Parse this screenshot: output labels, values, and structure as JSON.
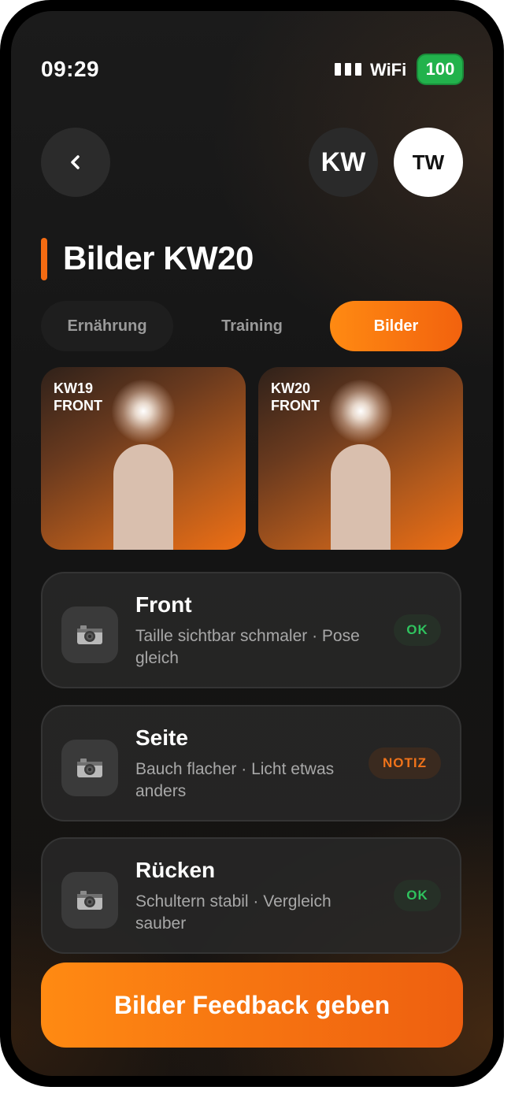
{
  "status_bar": {
    "time": "09:29",
    "network": "WiFi",
    "battery": "100",
    "battery_color": "#22b24c"
  },
  "header": {
    "back_icon": "chevron-left-icon",
    "avatar_primary": "KW",
    "avatar_secondary": "TW"
  },
  "page": {
    "title": "Bilder KW20",
    "accent_color": "#f46b12"
  },
  "tabs": [
    {
      "label": "Ernährung",
      "active": false
    },
    {
      "label": "Training",
      "active": false
    },
    {
      "label": "Bilder",
      "active": true
    }
  ],
  "photos": [
    {
      "week": "KW19",
      "view": "FRONT"
    },
    {
      "week": "KW20",
      "view": "FRONT"
    }
  ],
  "feedback": [
    {
      "icon": "camera-icon",
      "title": "Front",
      "description": "Taille sichtbar schmaler · Pose gleich",
      "status": "OK"
    },
    {
      "icon": "camera-icon",
      "title": "Seite",
      "description": "Bauch flacher · Licht etwas anders",
      "status": "NOTIZ"
    },
    {
      "icon": "camera-icon",
      "title": "Rücken",
      "description": "Schultern stabil · Vergleich sauber",
      "status": "OK"
    }
  ],
  "cta": {
    "label": "Bilder Feedback geben"
  }
}
